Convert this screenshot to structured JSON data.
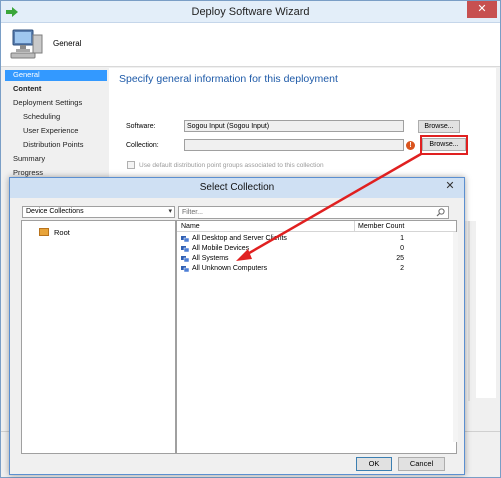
{
  "wizard": {
    "title": "Deploy Software Wizard",
    "close_glyph": "✕",
    "page_name": "General",
    "nav": [
      {
        "label": "General",
        "selected": true
      },
      {
        "label": "Content"
      },
      {
        "label": "Deployment Settings"
      },
      {
        "label": "Scheduling"
      },
      {
        "label": "User Experience"
      },
      {
        "label": "Distribution Points"
      },
      {
        "label": "Summary"
      },
      {
        "label": "Progress"
      }
    ],
    "heading": "Specify general information for this deployment",
    "software_label": "Software:",
    "software_value": "Sogou Input (Sogou Input)",
    "collection_label": "Collection:",
    "collection_value": "",
    "browse_label": "Browse...",
    "default_dp_checkbox_label": "Use default distribution point groups associated to this collection",
    "default_dp_checked": false
  },
  "dialog": {
    "title": "Select Collection",
    "close_glyph": "✕",
    "collection_type": "Device Collections",
    "tree_root": "Root",
    "filter_placeholder": "Filter...",
    "columns": {
      "name": "Name",
      "member_count": "Member Count"
    },
    "rows": [
      {
        "name": "All Desktop and Server Clients",
        "count": "1"
      },
      {
        "name": "All Mobile Devices",
        "count": "0"
      },
      {
        "name": "All Systems",
        "count": "25"
      },
      {
        "name": "All Unknown Computers",
        "count": "2"
      }
    ],
    "ok_label": "OK",
    "cancel_label": "Cancel"
  },
  "colors": {
    "accent": "#3399ff",
    "heading": "#1e5aa8",
    "annotation_red": "#e02020"
  }
}
